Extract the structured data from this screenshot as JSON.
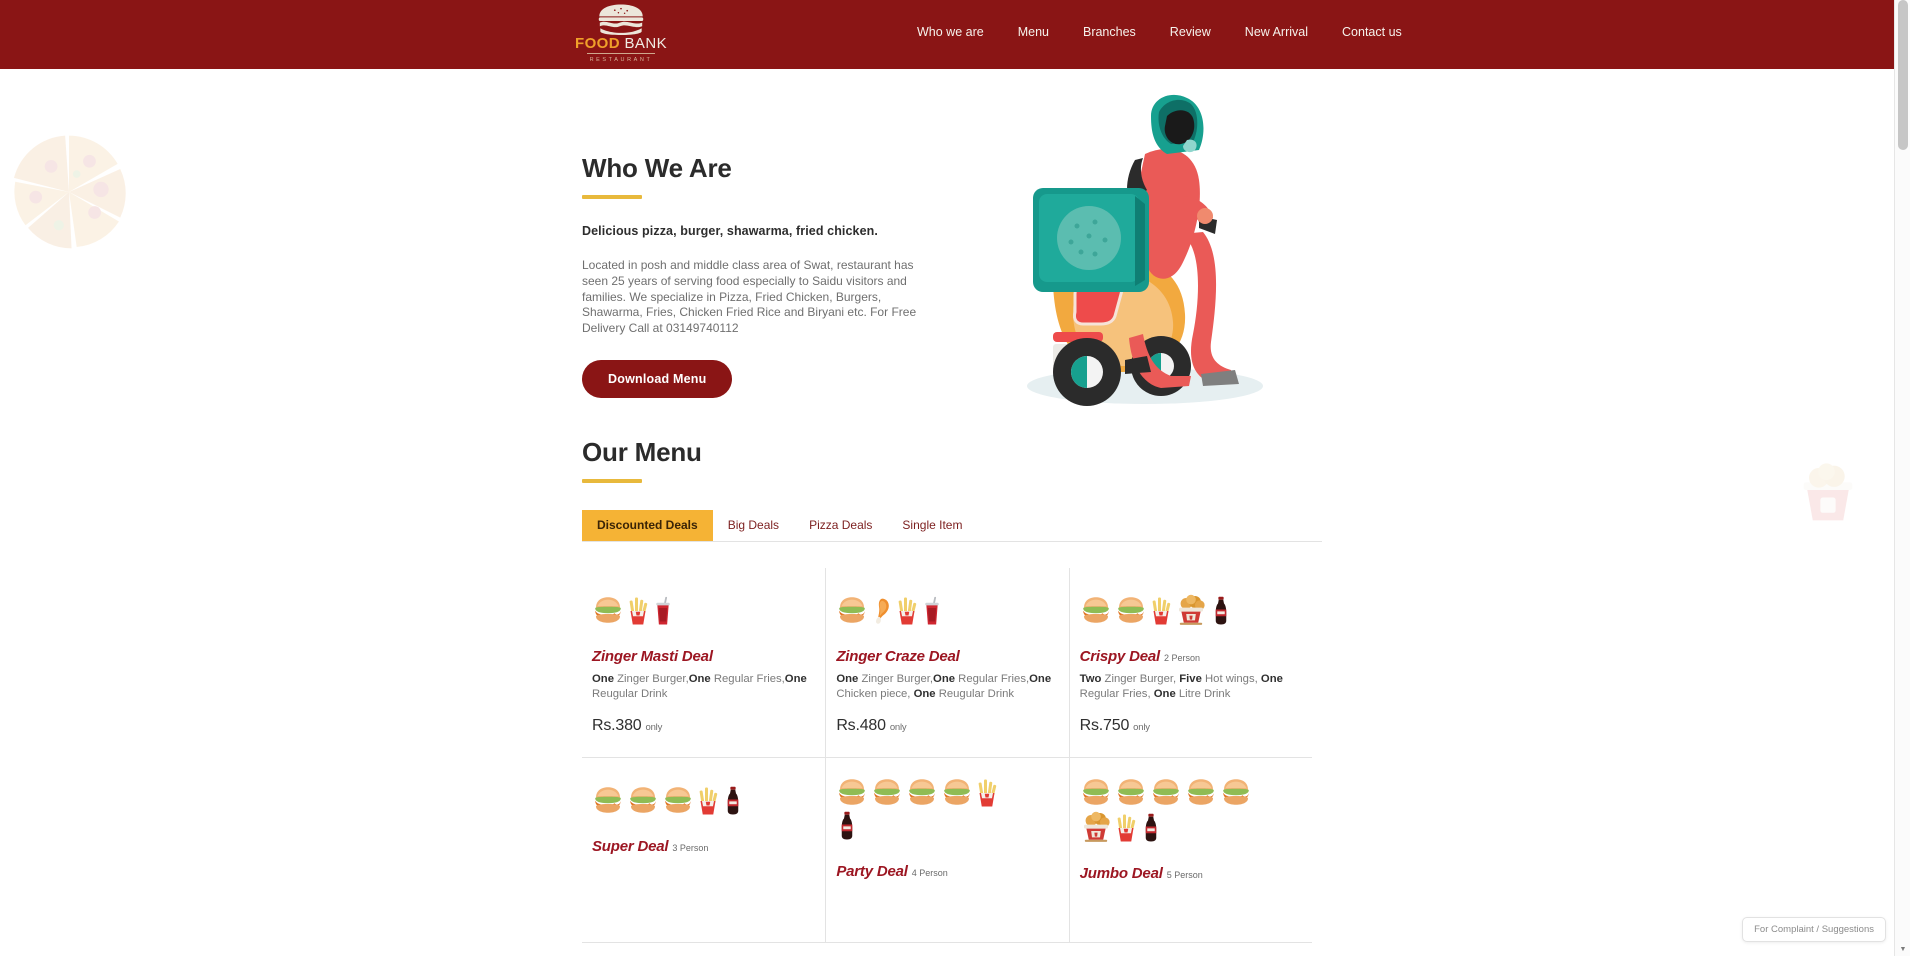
{
  "header": {
    "brand": {
      "logo_icon": "burger-logo-icon",
      "word_primary": "FOOD",
      "word_secondary": "BANK",
      "tagline": "RESTAURANT"
    },
    "nav": [
      {
        "label": "Who we are"
      },
      {
        "label": "Menu"
      },
      {
        "label": "Branches"
      },
      {
        "label": "Review"
      },
      {
        "label": "New Arrival"
      },
      {
        "label": "Contact us"
      }
    ]
  },
  "hero": {
    "title": "Who We Are",
    "lead": "Delicious pizza, burger, shawarma, fried chicken.",
    "body": "Located in posh and middle class area of Swat, restaurant has seen 25 years of serving food especially to Saidu visitors and families. We specialize in Pizza, Fried Chicken, Burgers, Shawarma, Fries, Chicken Fried Rice and Biryani etc. For Free Delivery Call at 03149740112",
    "cta_label": "Download Menu",
    "illustration_icon": "delivery-scooter-illustration"
  },
  "menu": {
    "title": "Our Menu",
    "tabs": [
      {
        "label": "Discounted Deals",
        "active": true
      },
      {
        "label": "Big Deals",
        "active": false
      },
      {
        "label": "Pizza Deals",
        "active": false
      },
      {
        "label": "Single Item",
        "active": false
      }
    ],
    "deals": [
      {
        "name": "Zinger Masti Deal",
        "persons": "",
        "items": [
          {
            "qty": "One",
            "text": " Zinger Burger,"
          },
          {
            "qty": "One",
            "text": " Regular Fries,"
          },
          {
            "qty": "One",
            "text": " Reugular Drink"
          }
        ],
        "price": "Rs.380",
        "price_note": "only",
        "images": [
          "burger",
          "fries",
          "drink-cup"
        ]
      },
      {
        "name": "Zinger Craze Deal",
        "persons": "",
        "items": [
          {
            "qty": "One",
            "text": " Zinger Burger,"
          },
          {
            "qty": "One",
            "text": " Regular Fries,"
          },
          {
            "qty": "One",
            "text": " Chicken piece, "
          },
          {
            "qty": "One",
            "text": " Reugular Drink"
          }
        ],
        "price": "Rs.480",
        "price_note": "only",
        "images": [
          "burger",
          "chicken-leg",
          "fries",
          "drink-cup"
        ]
      },
      {
        "name": "Crispy Deal",
        "persons": "2 Person",
        "items": [
          {
            "qty": "Two",
            "text": " Zinger Burger, "
          },
          {
            "qty": "Five",
            "text": " Hot wings, "
          },
          {
            "qty": "One",
            "text": " Regular Fries, "
          },
          {
            "qty": "One",
            "text": " Litre Drink"
          }
        ],
        "price": "Rs.750",
        "price_note": "only",
        "images": [
          "burger",
          "burger",
          "fries",
          "chicken-bucket",
          "cola-bottle"
        ]
      },
      {
        "name": "Super Deal",
        "persons": "3 Person",
        "items": [],
        "price": "",
        "price_note": "",
        "images": [
          "burger",
          "burger",
          "burger",
          "fries",
          "cola-bottle"
        ]
      },
      {
        "name": "Party Deal",
        "persons": "4 Person",
        "items": [],
        "price": "",
        "price_note": "",
        "images": [
          "burger",
          "burger",
          "burger",
          "burger",
          "fries",
          "cola-bottle"
        ]
      },
      {
        "name": "Jumbo Deal",
        "persons": "5 Person",
        "items": [],
        "price": "",
        "price_note": "",
        "images": [
          "burger",
          "burger",
          "burger",
          "burger",
          "burger",
          "chicken-bucket",
          "fries",
          "cola-bottle"
        ]
      }
    ]
  },
  "widgets": {
    "complaint_label": "For Complaint / Suggestions"
  },
  "decor": {
    "left_icon": "pizza-slices-decoration",
    "right_icon": "chicken-bucket-decoration"
  },
  "colors": {
    "brand_dark_red": "#8a1515",
    "accent_yellow": "#f5b335",
    "underline_gold": "#e8b93c",
    "title_red": "#9c1622",
    "logo_orange": "#f0a02a"
  }
}
